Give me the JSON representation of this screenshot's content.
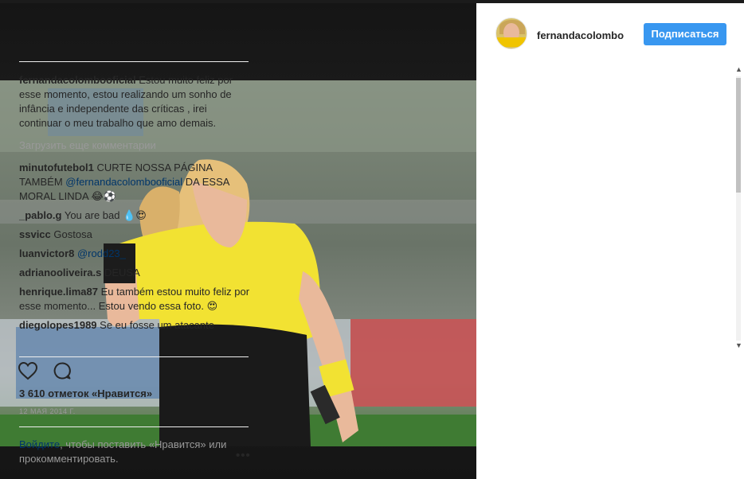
{
  "post": {
    "username": "fernandacolombo",
    "follow_label": "Подписаться"
  },
  "caption": {
    "user": "fernandacolombooficial",
    "text": "Estou muito feliz por esse momento, estou realizando um sonho de infância e independente das críticas , irei continuar o meu trabalho que amo demais."
  },
  "load_more": "Загрузить еще комментарии",
  "comments": [
    {
      "user": "minutofutebol1",
      "text": "CURTE NOSSA PÁGINA TAMBÉM ",
      "mention": "@fernandacolombooficial",
      "after": " DA ESSA MORAL LINDA 😂⚽"
    },
    {
      "user": "_pablo.g",
      "text": "You are bad 💧😍",
      "mention": "",
      "after": ""
    },
    {
      "user": "ssvicc",
      "text": "Gostosa",
      "mention": "",
      "after": ""
    },
    {
      "user": "luanvictor8",
      "text": "",
      "mention": "@rodd23_",
      "after": ""
    },
    {
      "user": "adrianooliveira.s",
      "text": "DEUSA",
      "mention": "",
      "after": ""
    },
    {
      "user": "henrique.lima87",
      "text": "Eu também estou muito feliz por esse momento... Estou vendo essa foto. 😍",
      "mention": "",
      "after": ""
    },
    {
      "user": "diegolopes1989",
      "text": "Se eu fosse um atacante",
      "mention": "",
      "after": ""
    }
  ],
  "icons": {
    "like": "heart-icon",
    "comment": "comment-bubble-icon",
    "more": "more-options-icon"
  },
  "likes": "3 610 отметок «Нравится»",
  "date": "12 МАЯ 2014 Г.",
  "login_prompt": {
    "link": "Войдите",
    "text": ", чтобы поставить «Нравится» или прокомментировать."
  },
  "more_label": "•••",
  "colors": {
    "accent": "#3897f0",
    "link": "#003569",
    "muted": "#999999"
  }
}
